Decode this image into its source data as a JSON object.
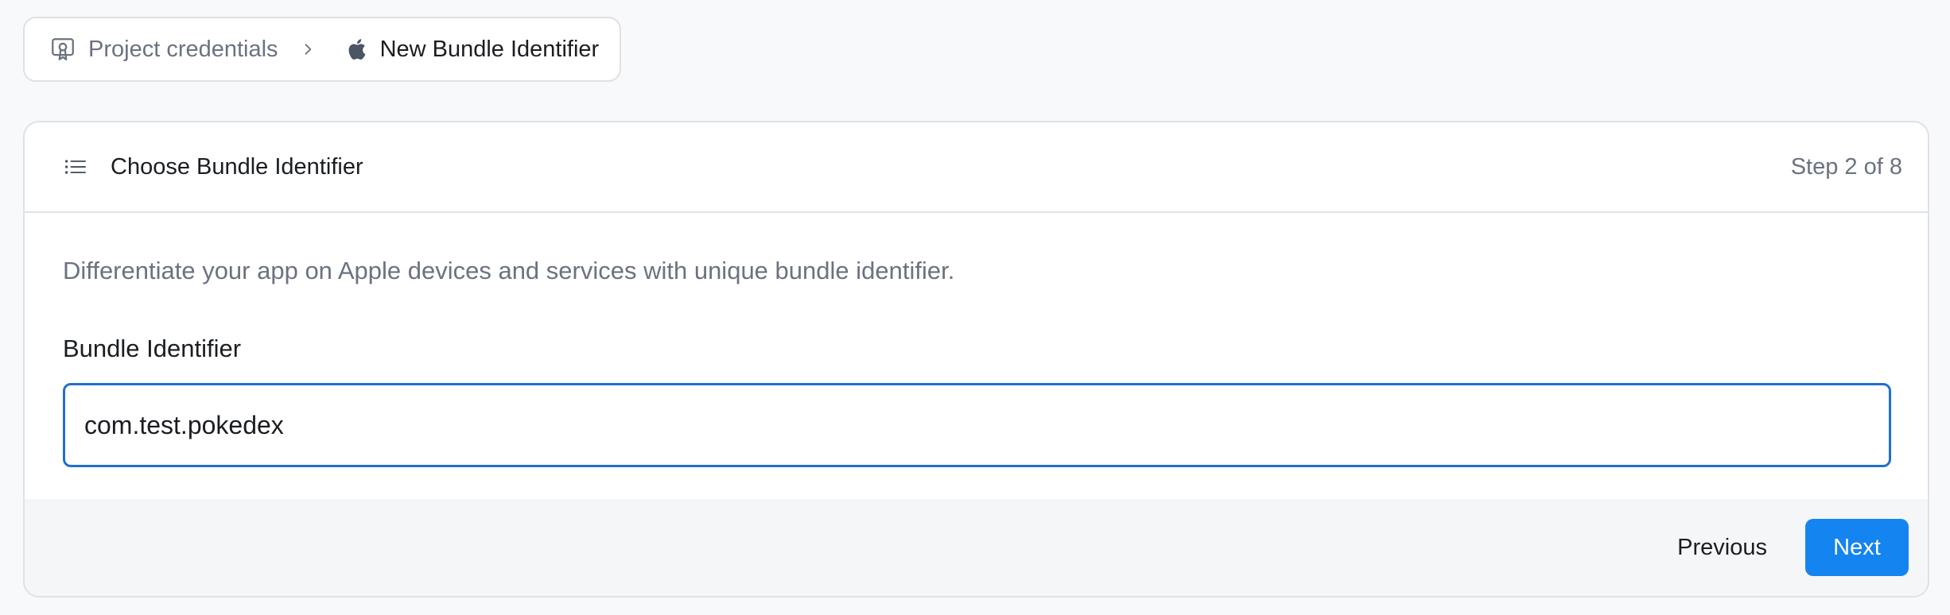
{
  "breadcrumb": {
    "parent_label": "Project credentials",
    "current_label": "New Bundle Identifier",
    "icons": {
      "parent": "certificate-icon",
      "separator": "chevron-right-icon",
      "current": "apple-icon"
    }
  },
  "card": {
    "title": "Choose Bundle Identifier",
    "title_icon": "list-icon",
    "step": "Step 2 of 8",
    "description": "Differentiate your app on Apple devices and services with unique bundle identifier.",
    "field_label": "Bundle Identifier",
    "bundle_identifier_value": "com.test.pokedex"
  },
  "footer": {
    "previous_label": "Previous",
    "next_label": "Next"
  },
  "colors": {
    "accent": "#1484f0",
    "input_focus_border": "#1f6fd1",
    "muted_text": "#6b7280",
    "page_background": "#f8f9fb"
  }
}
